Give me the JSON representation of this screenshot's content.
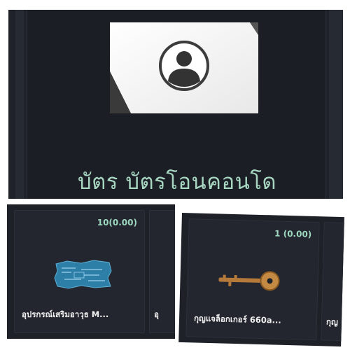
{
  "top_card": {
    "title": "บัตร บัตรโอนคอนโด",
    "icon": "user-avatar-icon"
  },
  "items": [
    {
      "quantity": "10(0.00)",
      "name": "อุปรกรณ์เสริมอาวุธ M...",
      "icon": "blueprint-map-icon",
      "next_name": "อุ"
    },
    {
      "quantity": "1 (0.00)",
      "name": "กุญแจล็อกเกอร์ 660a...",
      "icon": "key-icon",
      "next_name": "กุญ"
    }
  ],
  "colors": {
    "background": "#1f2229",
    "accent_text": "#a7d6c1",
    "quantity_text": "#9ed7bf"
  }
}
